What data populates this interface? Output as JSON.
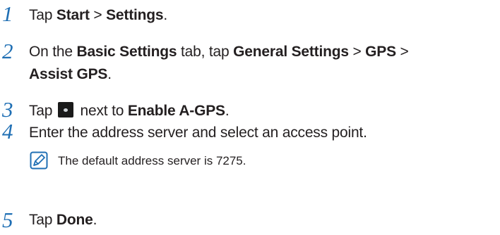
{
  "steps": [
    {
      "number": "1",
      "parts": [
        {
          "text": "Tap "
        },
        {
          "text": "Start",
          "bold": true
        },
        {
          "text": " > "
        },
        {
          "text": "Settings",
          "bold": true
        },
        {
          "text": "."
        }
      ]
    },
    {
      "number": "2",
      "parts": [
        {
          "text": "On the "
        },
        {
          "text": "Basic Settings",
          "bold": true
        },
        {
          "text": " tab, tap "
        },
        {
          "text": "General Settings",
          "bold": true
        },
        {
          "text": " > "
        },
        {
          "text": "GPS",
          "bold": true
        },
        {
          "text": " > "
        },
        {
          "text": "Assist GPS",
          "bold": true
        },
        {
          "text": "."
        }
      ]
    },
    {
      "number": "3",
      "parts": [
        {
          "text": "Tap "
        },
        {
          "icon": "toggle-button-icon"
        },
        {
          "text": " next to "
        },
        {
          "text": "Enable A-GPS",
          "bold": true
        },
        {
          "text": "."
        }
      ]
    },
    {
      "number": "4",
      "parts": [
        {
          "text": "Enter the address server and select an access point."
        }
      ]
    },
    {
      "number": "5",
      "parts": [
        {
          "text": "Tap "
        },
        {
          "text": "Done",
          "bold": true
        },
        {
          "text": "."
        }
      ]
    }
  ],
  "note": {
    "icon": "note-pencil-icon",
    "text": "The default address server is 7275."
  },
  "colors": {
    "step_number": "#1f6fb4",
    "body_text": "#231f20",
    "note_icon": "#1f6fb4"
  }
}
